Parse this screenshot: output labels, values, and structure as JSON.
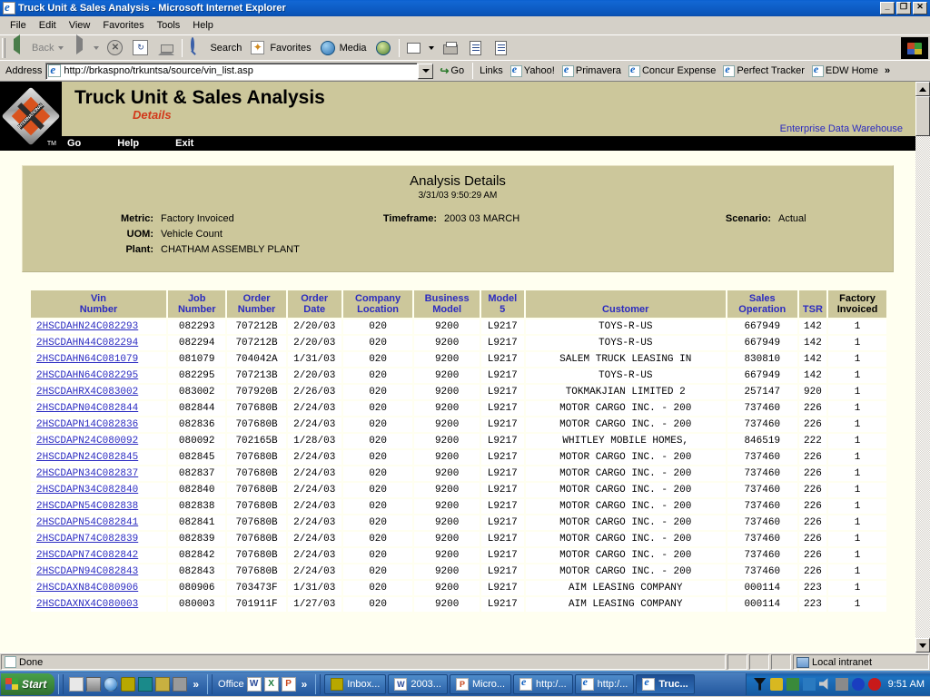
{
  "window": {
    "title": "Truck Unit & Sales Analysis - Microsoft Internet Explorer",
    "minimize_label": "_",
    "maximize_label": "❐",
    "close_label": "✕"
  },
  "menubar": {
    "items": [
      "File",
      "Edit",
      "View",
      "Favorites",
      "Tools",
      "Help"
    ]
  },
  "toolbar": {
    "back_label": "Back",
    "forward_label": "",
    "stop_label": "",
    "refresh_label": "",
    "home_label": "",
    "search_label": "Search",
    "favorites_label": "Favorites",
    "media_label": "Media",
    "history_label": "",
    "mail_label": "",
    "print_label": "",
    "edit_label": "",
    "discuss_label": ""
  },
  "address": {
    "label": "Address",
    "url": "http://brkaspno/trkuntsa/source/vin_list.asp",
    "go_label": "Go",
    "links_label": "Links",
    "links": [
      "Yahoo!",
      "Primavera",
      "Concur Expense",
      "Perfect Tracker",
      "EDW Home"
    ],
    "overflow_label": "»"
  },
  "site": {
    "logo_text": "INTERNATIONAL",
    "logo_tm": "TM",
    "title": "Truck Unit & Sales Analysis",
    "subtitle": "Details",
    "edw_link": "Enterprise Data Warehouse",
    "nav": [
      "Go",
      "Help",
      "Exit"
    ]
  },
  "details": {
    "heading": "Analysis Details",
    "timestamp": "3/31/03 9:50:29 AM",
    "fields": [
      {
        "label": "Metric:",
        "value": "Factory Invoiced"
      },
      {
        "label": "UOM:",
        "value": "Vehicle Count"
      },
      {
        "label": "Plant:",
        "value": "CHATHAM ASSEMBLY PLANT"
      },
      {
        "label": "Timeframe:",
        "value": "2003 03 MARCH"
      },
      {
        "label": "Scenario:",
        "value": "Actual"
      }
    ]
  },
  "table": {
    "columns": [
      {
        "line1": "Vin",
        "line2": "Number",
        "color": "#2b2bc0"
      },
      {
        "line1": "Job",
        "line2": "Number",
        "color": "#2b2bc0"
      },
      {
        "line1": "Order",
        "line2": "Number",
        "color": "#2b2bc0"
      },
      {
        "line1": "Order",
        "line2": "Date",
        "color": "#2b2bc0"
      },
      {
        "line1": "Company",
        "line2": "Location",
        "color": "#2b2bc0"
      },
      {
        "line1": "Business",
        "line2": "Model",
        "color": "#2b2bc0"
      },
      {
        "line1": "Model",
        "line2": "5",
        "color": "#2b2bc0"
      },
      {
        "line1": "",
        "line2": "Customer",
        "color": "#2b2bc0"
      },
      {
        "line1": "Sales",
        "line2": "Operation",
        "color": "#2b2bc0"
      },
      {
        "line1": "",
        "line2": "TSR",
        "color": "#2b2bc0"
      },
      {
        "line1": "Factory",
        "line2": "Invoiced",
        "color": "#000000"
      }
    ],
    "rows": [
      [
        "2HSCDAHN24C082293",
        "082293",
        "707212B",
        "2/20/03",
        "020",
        "9200",
        "L9217",
        "TOYS-R-US",
        "667949",
        "142",
        "1"
      ],
      [
        "2HSCDAHN44C082294",
        "082294",
        "707212B",
        "2/20/03",
        "020",
        "9200",
        "L9217",
        "TOYS-R-US",
        "667949",
        "142",
        "1"
      ],
      [
        "2HSCDAHN64C081079",
        "081079",
        "704042A",
        "1/31/03",
        "020",
        "9200",
        "L9217",
        "SALEM TRUCK LEASING IN",
        "830810",
        "142",
        "1"
      ],
      [
        "2HSCDAHN64C082295",
        "082295",
        "707213B",
        "2/20/03",
        "020",
        "9200",
        "L9217",
        "TOYS-R-US",
        "667949",
        "142",
        "1"
      ],
      [
        "2HSCDAHRX4C083002",
        "083002",
        "707920B",
        "2/26/03",
        "020",
        "9200",
        "L9217",
        "TOKMAKJIAN LIMITED 2",
        "257147",
        "920",
        "1"
      ],
      [
        "2HSCDAPN04C082844",
        "082844",
        "707680B",
        "2/24/03",
        "020",
        "9200",
        "L9217",
        "MOTOR CARGO INC. - 200",
        "737460",
        "226",
        "1"
      ],
      [
        "2HSCDAPN14C082836",
        "082836",
        "707680B",
        "2/24/03",
        "020",
        "9200",
        "L9217",
        "MOTOR CARGO INC. - 200",
        "737460",
        "226",
        "1"
      ],
      [
        "2HSCDAPN24C080092",
        "080092",
        "702165B",
        "1/28/03",
        "020",
        "9200",
        "L9217",
        "WHITLEY MOBILE HOMES,",
        "846519",
        "222",
        "1"
      ],
      [
        "2HSCDAPN24C082845",
        "082845",
        "707680B",
        "2/24/03",
        "020",
        "9200",
        "L9217",
        "MOTOR CARGO INC. - 200",
        "737460",
        "226",
        "1"
      ],
      [
        "2HSCDAPN34C082837",
        "082837",
        "707680B",
        "2/24/03",
        "020",
        "9200",
        "L9217",
        "MOTOR CARGO INC. - 200",
        "737460",
        "226",
        "1"
      ],
      [
        "2HSCDAPN34C082840",
        "082840",
        "707680B",
        "2/24/03",
        "020",
        "9200",
        "L9217",
        "MOTOR CARGO INC. - 200",
        "737460",
        "226",
        "1"
      ],
      [
        "2HSCDAPN54C082838",
        "082838",
        "707680B",
        "2/24/03",
        "020",
        "9200",
        "L9217",
        "MOTOR CARGO INC. - 200",
        "737460",
        "226",
        "1"
      ],
      [
        "2HSCDAPN54C082841",
        "082841",
        "707680B",
        "2/24/03",
        "020",
        "9200",
        "L9217",
        "MOTOR CARGO INC. - 200",
        "737460",
        "226",
        "1"
      ],
      [
        "2HSCDAPN74C082839",
        "082839",
        "707680B",
        "2/24/03",
        "020",
        "9200",
        "L9217",
        "MOTOR CARGO INC. - 200",
        "737460",
        "226",
        "1"
      ],
      [
        "2HSCDAPN74C082842",
        "082842",
        "707680B",
        "2/24/03",
        "020",
        "9200",
        "L9217",
        "MOTOR CARGO INC. - 200",
        "737460",
        "226",
        "1"
      ],
      [
        "2HSCDAPN94C082843",
        "082843",
        "707680B",
        "2/24/03",
        "020",
        "9200",
        "L9217",
        "MOTOR CARGO INC. - 200",
        "737460",
        "226",
        "1"
      ],
      [
        "2HSCDAXN84C080906",
        "080906",
        "703473F",
        "1/31/03",
        "020",
        "9200",
        "L9217",
        "AIM LEASING COMPANY",
        "000114",
        "223",
        "1"
      ],
      [
        "2HSCDAXNX4C080003",
        "080003",
        "701911F",
        "1/27/03",
        "020",
        "9200",
        "L9217",
        "AIM LEASING COMPANY",
        "000114",
        "223",
        "1"
      ]
    ]
  },
  "statusbar": {
    "message": "Done",
    "zone": "Local intranet"
  },
  "taskbar": {
    "start_label": "Start",
    "quicklaunch_overflow": "»",
    "office_label": "Office",
    "office_overflow": "»",
    "buttons": [
      {
        "label": "Inbox...",
        "active": false
      },
      {
        "label": "2003...",
        "active": false
      },
      {
        "label": "Micro...",
        "active": false
      },
      {
        "label": "http:/...",
        "active": false
      },
      {
        "label": "http:/...",
        "active": false
      },
      {
        "label": "Truc...",
        "active": true
      }
    ],
    "clock": "9:51 AM"
  },
  "colors": {
    "tan": "#ccc79b",
    "page_bg": "#fffff0",
    "link": "#2b2bc0",
    "accent_red": "#d2381a",
    "chrome": "#d4d0c8"
  }
}
